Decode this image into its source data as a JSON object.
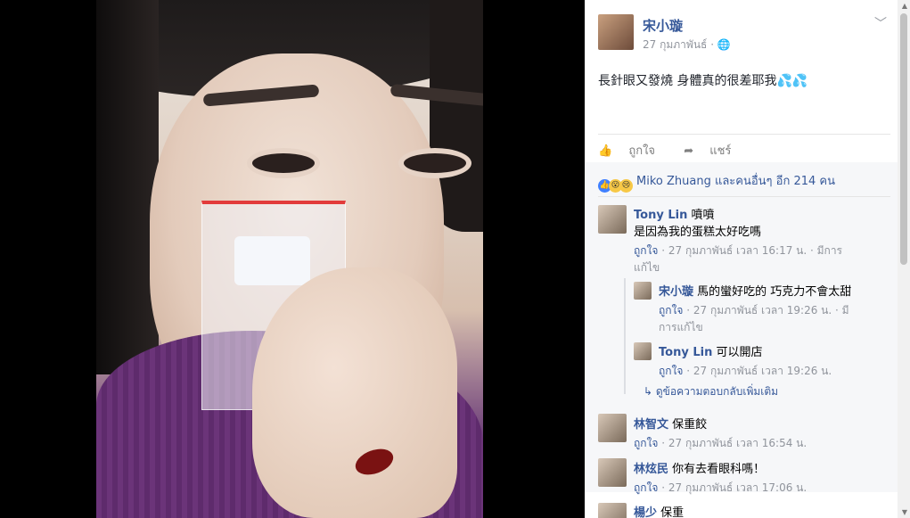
{
  "post": {
    "author": "宋小璇",
    "date": "27 กุมภาพันธ์",
    "separator": "·",
    "globe_icon": "globe-icon",
    "text": "長針眼又發燒 身體真的很差耶我💦💦",
    "like_label": "ถูกใจ",
    "share_label": "แชร์"
  },
  "reactions": {
    "text": "Miko Zhuang และคนอื่นๆ อีก 214 คน"
  },
  "comments": [
    {
      "name": "Tony Lin",
      "text": "噴噴",
      "text2": "是因為我的蛋糕太好吃嗎",
      "like": "ถูกใจ",
      "meta": "· 27 กุมภาพันธ์ เวลา 16:17 น. · มีการ",
      "meta2": "แก้ไข"
    },
    {
      "name": "宋小璇",
      "text": "馬的蠻好吃的 巧克力不會太甜",
      "like": "ถูกใจ",
      "meta": "· 27 กุมภาพันธ์ เวลา 19:26 น. · มี",
      "meta2": "การแก้ไข"
    },
    {
      "name": "Tony Lin",
      "text": "可以開店",
      "like": "ถูกใจ",
      "meta": "· 27 กุมภาพันธ์ เวลา 19:26 น."
    },
    {
      "name": "林智文",
      "text": "保重餃",
      "like": "ถูกใจ",
      "meta": "· 27 กุมภาพันธ์ เวลา 16:54 น."
    },
    {
      "name": "林炫民",
      "text": "你有去看眼科嗎！",
      "like": "ถูกใจ",
      "meta": "· 27 กุมภาพันธ์ เวลา 17:06 น."
    },
    {
      "name": "楊少",
      "text": "保重"
    }
  ],
  "more_replies": "ดูข้อความตอบกลับเพิ่มเติม",
  "colors": {
    "link": "#365899",
    "meta": "#90949c",
    "sweater": "#6b3479"
  }
}
